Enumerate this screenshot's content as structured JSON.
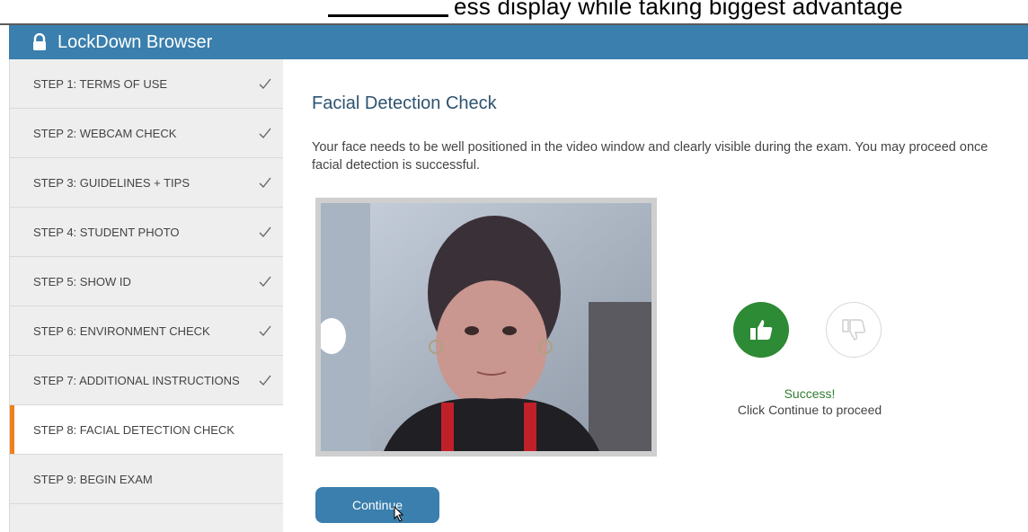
{
  "app": {
    "title": "LockDown Browser"
  },
  "top_strip": {
    "text": "ess display while taking biggest advantage"
  },
  "sidebar": {
    "steps": [
      {
        "label": "STEP 1: TERMS OF USE",
        "done": true
      },
      {
        "label": "STEP 2: WEBCAM CHECK",
        "done": true
      },
      {
        "label": "STEP 3: GUIDELINES + TIPS",
        "done": true
      },
      {
        "label": "STEP 4: STUDENT PHOTO",
        "done": true
      },
      {
        "label": "STEP 5: SHOW ID",
        "done": true
      },
      {
        "label": "STEP 6: ENVIRONMENT CHECK",
        "done": true
      },
      {
        "label": "STEP 7: ADDITIONAL INSTRUCTIONS",
        "done": true
      },
      {
        "label": "STEP 8: FACIAL DETECTION CHECK",
        "done": false,
        "active": true
      },
      {
        "label": "STEP 9: BEGIN EXAM",
        "done": false
      }
    ]
  },
  "main": {
    "heading": "Facial Detection Check",
    "description": "Your face needs to be well positioned in the video window and clearly visible during the exam. You may proceed once facial detection is successful.",
    "status_title": "Success!",
    "status_text": "Click Continue to proceed",
    "continue_label": "Continue"
  },
  "icons": {
    "lock": "lock-icon",
    "check": "checkmark-icon",
    "thumbs_up": "thumbs-up-icon",
    "thumbs_down": "thumbs-down-icon",
    "cursor": "mouse-cursor-icon"
  },
  "colors": {
    "titlebar": "#3a7fad",
    "active_marker": "#f0801d",
    "success": "#2d8a35",
    "button": "#3a7fad"
  }
}
